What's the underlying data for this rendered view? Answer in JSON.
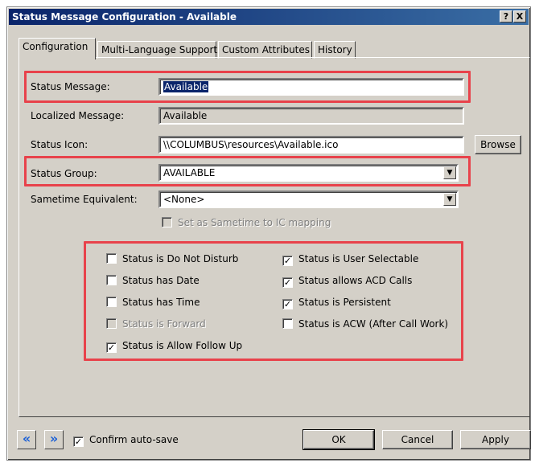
{
  "window": {
    "title": "Status Message Configuration - Available",
    "help_label": "?",
    "close_label": "X"
  },
  "tabs": [
    {
      "label": "Configuration",
      "active": true
    },
    {
      "label": "Multi-Language Support",
      "active": false
    },
    {
      "label": "Custom Attributes",
      "active": false
    },
    {
      "label": "History",
      "active": false
    }
  ],
  "form": {
    "status_message_label": "Status Message:",
    "status_message_value": "Available",
    "localized_message_label": "Localized Message:",
    "localized_message_value": "Available",
    "status_icon_label": "Status Icon:",
    "status_icon_value": "\\\\COLUMBUS\\resources\\Available.ico",
    "browse_label": "Browse",
    "status_group_label": "Status Group:",
    "status_group_value": "AVAILABLE",
    "sametime_label": "Sametime Equivalent:",
    "sametime_value": "<None>",
    "sametime_mapping_label": "Set as Sametime to IC mapping"
  },
  "checkboxes": {
    "left": [
      {
        "label": "Status is Do Not Disturb",
        "checked": false,
        "disabled": false
      },
      {
        "label": "Status has Date",
        "checked": false,
        "disabled": false
      },
      {
        "label": "Status has Time",
        "checked": false,
        "disabled": false
      },
      {
        "label": "Status is Forward",
        "checked": false,
        "disabled": true
      },
      {
        "label": "Status is Allow Follow Up",
        "checked": true,
        "disabled": false
      }
    ],
    "right": [
      {
        "label": "Status is User Selectable",
        "checked": true,
        "disabled": false
      },
      {
        "label": "Status allows ACD Calls",
        "checked": true,
        "disabled": false
      },
      {
        "label": "Status is Persistent",
        "checked": true,
        "disabled": false
      },
      {
        "label": "Status is ACW (After Call Work)",
        "checked": false,
        "disabled": false
      }
    ]
  },
  "footer": {
    "prev_icon": "double-chevron-left-icon",
    "next_icon": "double-chevron-right-icon",
    "confirm_autosave_label": "Confirm auto-save",
    "confirm_autosave_checked": true,
    "ok_label": "OK",
    "cancel_label": "Cancel",
    "apply_label": "Apply"
  },
  "colors": {
    "highlight": "#e8424b",
    "titlebar": "#0a246a",
    "nav_icon": "#1a5fd6"
  }
}
